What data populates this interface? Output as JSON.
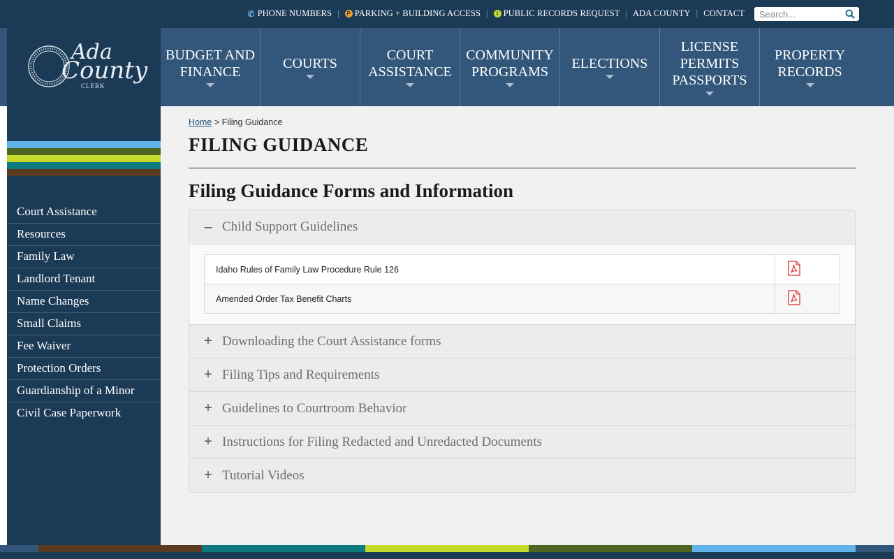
{
  "utility": {
    "phone": "PHONE NUMBERS",
    "parking": "PARKING + BUILDING ACCESS",
    "records": "PUBLIC RECORDS REQUEST",
    "county": "ADA COUNTY",
    "contact": "CONTACT",
    "search_placeholder": "Search..."
  },
  "logo": {
    "word1": "Ada",
    "word2": "County",
    "word3": "CLERK"
  },
  "nav": [
    {
      "line1": "BUDGET AND",
      "line2": "FINANCE"
    },
    {
      "line1": "COURTS",
      "line2": ""
    },
    {
      "line1": "COURT",
      "line2": "ASSISTANCE"
    },
    {
      "line1": "COMMUNITY",
      "line2": "PROGRAMS"
    },
    {
      "line1": "ELECTIONS",
      "line2": ""
    },
    {
      "line1": "LICENSE",
      "line2": "PERMITS",
      "line3": "PASSPORTS"
    },
    {
      "line1": "PROPERTY",
      "line2": "RECORDS"
    }
  ],
  "sidebar": {
    "items": [
      "Court Assistance",
      "Resources",
      "Family Law",
      "Landlord Tenant",
      "Name Changes",
      "Small Claims",
      "Fee Waiver",
      "Protection Orders",
      "Guardianship of a Minor",
      "Civil Case Paperwork"
    ]
  },
  "breadcrumb": {
    "home": "Home",
    "sep": " > ",
    "current": "Filing Guidance"
  },
  "page": {
    "title": "FILING GUIDANCE",
    "subtitle": "Filing Guidance Forms and Information"
  },
  "accordion": {
    "open_section": {
      "title": "Child Support Guidelines",
      "symbol": "–",
      "docs": [
        "Idaho Rules of Family Law Procedure Rule 126",
        "Amended Order Tax Benefit Charts"
      ]
    },
    "closed_symbol": "+",
    "sections": [
      "Downloading the Court Assistance forms",
      "Filing Tips and Requirements",
      "Guidelines to Courtroom Behavior",
      "Instructions for Filing Redacted and Unredacted Documents",
      "Tutorial Videos"
    ]
  },
  "colors": {
    "navy": "#1b3a55",
    "header_blue": "#33577a",
    "stripe_blue": "#5fb2ea",
    "stripe_olive": "#4e6522",
    "stripe_lime": "#c6d92d",
    "stripe_teal": "#0d7a80",
    "stripe_brown": "#5a3a21",
    "pdf_red": "#d9302c"
  }
}
